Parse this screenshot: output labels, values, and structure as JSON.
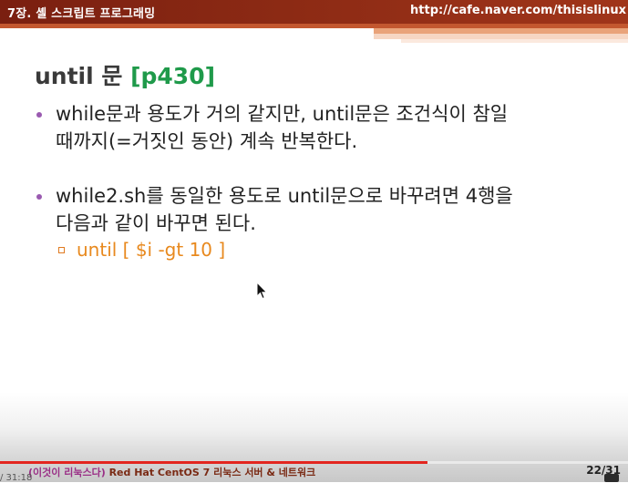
{
  "header": {
    "chapter_title": "7장. 셸 스크립트 프로그래밍",
    "url": "http://cafe.naver.com/thisislinux"
  },
  "slide": {
    "title_main": "until 문 ",
    "title_ref": "[p430]",
    "bullet1": {
      "line1": "while문과 용도가 거의 같지만, until문은 조건식이 참일",
      "line2": "때까지(=거짓인 동안) 계속 반복한다."
    },
    "bullet2": {
      "line1": "while2.sh를 동일한 용도로 until문으로 바꾸려면 4행을",
      "line2": "다음과 같이 바꾸면 된다.",
      "sub_code": "until [ $i -gt 10 ]"
    }
  },
  "footer": {
    "series_paren": "(이것이 리눅스다)",
    "book_title": " Red Hat CentOS 7 리눅스 서버 & 네트워크",
    "page_number": "22/31"
  },
  "player": {
    "time_display": "/ 31:18",
    "progress": 0.68
  },
  "colors": {
    "header_bg": "#8c2a14",
    "title_ref": "#1f9a4a",
    "bullet_dot": "#9a5ab0",
    "code_text": "#e8891e",
    "progress_fill": "#e3261f"
  }
}
